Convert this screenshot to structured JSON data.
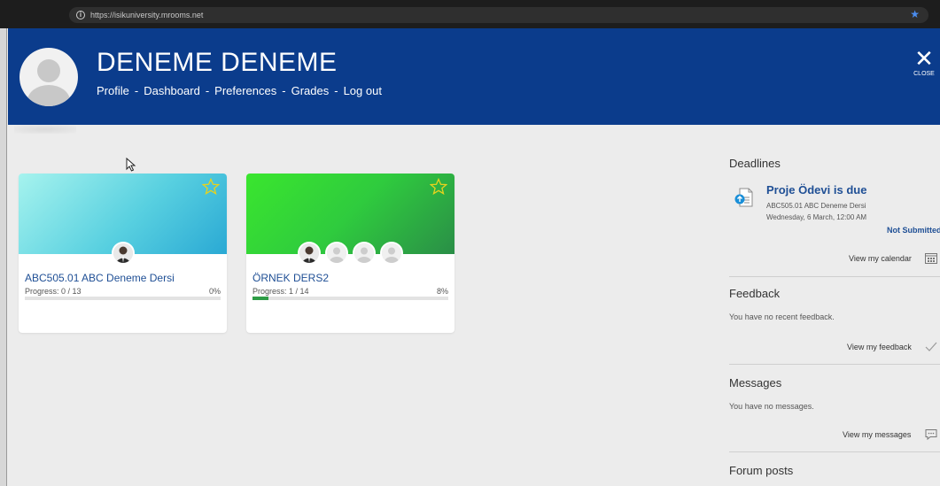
{
  "browser": {
    "url": "https://isikuniversity.mrooms.net"
  },
  "header": {
    "user_name": "DENEME DENEME",
    "nav": [
      "Profile",
      "Dashboard",
      "Preferences",
      "Grades",
      "Log out"
    ],
    "separator": "-",
    "close_label": "CLOSE",
    "bg_color": "#0b3c8c"
  },
  "courses": [
    {
      "title": "ABC505.01 ABC Deneme Dersi",
      "progress_text": "Progress: 0 / 13",
      "percent_text": "0%",
      "progress": 0,
      "avatars": 1,
      "banner": "linear-gradient(135deg,#a6f3ee 0%,#58d0e0 55%,#2aa9d4 100%)"
    },
    {
      "title": "ÖRNEK DERS2",
      "progress_text": "Progress: 1 / 14",
      "percent_text": "8%",
      "progress": 0.08,
      "avatars": 4,
      "banner": "linear-gradient(135deg,#3ae62e 0%,#2fcb3e 50%,#2a8e47 100%)"
    }
  ],
  "sidebar": {
    "deadlines": {
      "heading": "Deadlines",
      "item_title": "Proje Ödevi is due",
      "item_course": "ABC505.01 ABC Deneme Dersi",
      "item_date": "Wednesday, 6 March, 12:00 AM",
      "status": "Not Submitted",
      "link": "View my calendar"
    },
    "feedback": {
      "heading": "Feedback",
      "empty": "You have no recent feedback.",
      "link": "View my feedback"
    },
    "messages": {
      "heading": "Messages",
      "empty": "You have no messages.",
      "link": "View my messages"
    },
    "forum": {
      "heading": "Forum posts"
    }
  }
}
